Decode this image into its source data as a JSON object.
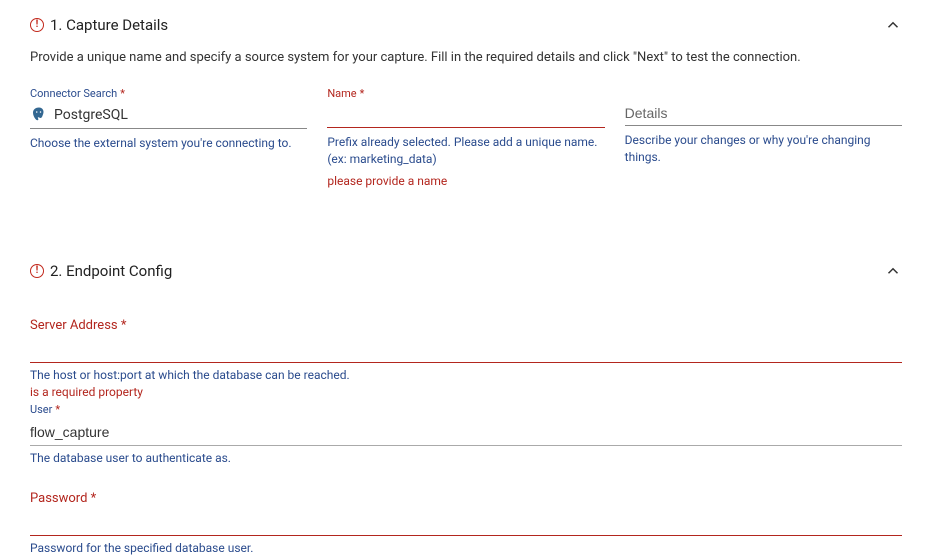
{
  "section1": {
    "title": "1. Capture Details",
    "description": "Provide a unique name and specify a source system for your capture. Fill in the required details and click \"Next\" to test the connection.",
    "connector": {
      "label": "Connector Search",
      "value": "PostgreSQL",
      "helper": "Choose the external system you're connecting to."
    },
    "name": {
      "label": "Name",
      "value": "",
      "helper": "Prefix already selected. Please add a unique name. (ex: marketing_data)",
      "error": "please provide a name"
    },
    "details": {
      "placeholder": "Details",
      "helper": "Describe your changes or why you're changing things."
    }
  },
  "section2": {
    "title": "2. Endpoint Config",
    "server": {
      "label": "Server Address *",
      "value": "",
      "helper": "The host or host:port at which the database can be reached.",
      "error": "is a required property"
    },
    "user": {
      "label": "User",
      "value": "flow_capture",
      "helper": "The database user to authenticate as."
    },
    "password": {
      "label": "Password *",
      "helper": "Password for the specified database user."
    }
  }
}
